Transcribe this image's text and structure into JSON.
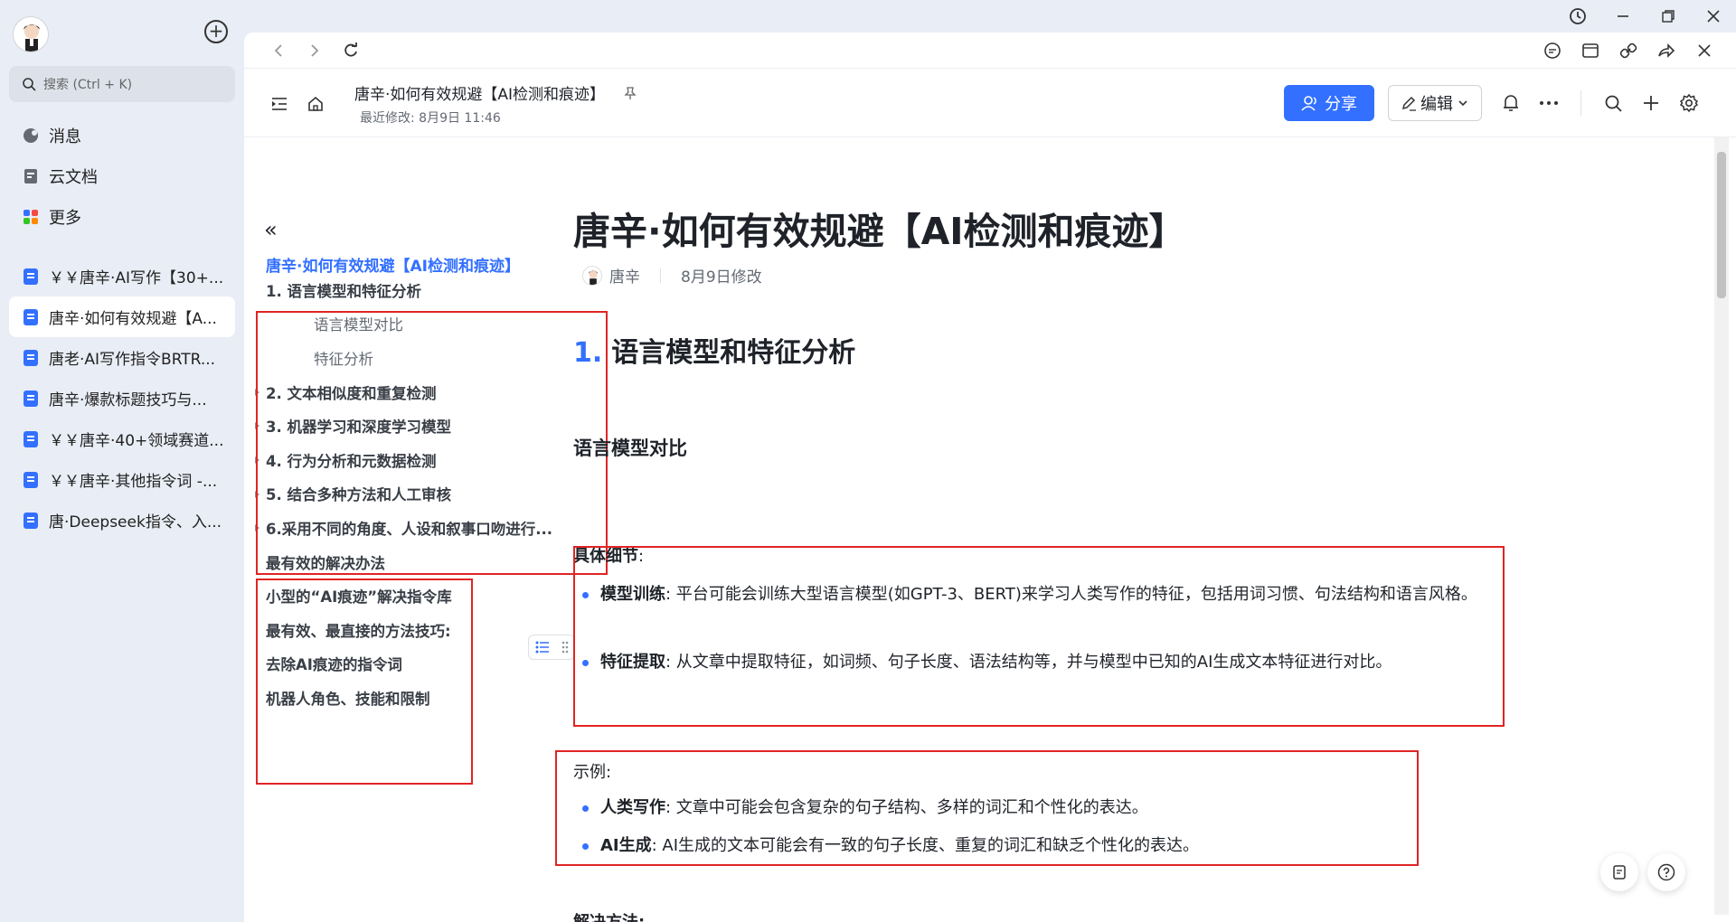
{
  "sidebar": {
    "search_placeholder": "搜索 (Ctrl + K)",
    "nav": [
      {
        "label": "消息",
        "icon": "message-icon"
      },
      {
        "label": "云文档",
        "icon": "cloud-doc-icon"
      },
      {
        "label": "更多",
        "icon": "apps-icon"
      }
    ],
    "docs": [
      {
        "label": "￥￥唐辛·AI写作【30+..."
      },
      {
        "label": "唐辛·如何有效规避【A...",
        "active": true
      },
      {
        "label": "唐老·AI写作指令BRTR..."
      },
      {
        "label": "唐辛·爆款标题技巧与..."
      },
      {
        "label": "￥￥唐辛·40+领域赛道..."
      },
      {
        "label": "￥￥唐辛·其他指令词 -..."
      },
      {
        "label": "唐·Deepseek指令、入..."
      }
    ]
  },
  "header": {
    "title": "唐辛·如何有效规避【AI检测和痕迹】",
    "last_modified": "最近修改: 8月9日 11:46",
    "share_label": "分享",
    "edit_label": "编辑"
  },
  "outline": {
    "title": "唐辛·如何有效规避【AI检测和痕迹】",
    "items": [
      {
        "label": "1. 语言模型和特征分析",
        "level": 1
      },
      {
        "label": "语言模型对比",
        "level": 2
      },
      {
        "label": "特征分析",
        "level": 2
      },
      {
        "label": "2. 文本相似度和重复检测",
        "level": 1
      },
      {
        "label": "3. 机器学习和深度学习模型",
        "level": 1
      },
      {
        "label": "4. 行为分析和元数据检测",
        "level": 1
      },
      {
        "label": "5. 结合多种方法和人工审核",
        "level": 1
      },
      {
        "label": "6.采用不同的角度、人设和叙事口吻进行...",
        "level": 1
      },
      {
        "label": "最有效的解决办法",
        "level": 1
      },
      {
        "label": "小型的“AI痕迹”解决指令库",
        "level": 1
      },
      {
        "label": "最有效、最直接的方法技巧:",
        "level": 1
      },
      {
        "label": "去除AI痕迹的指令词",
        "level": 1
      },
      {
        "label": "机器人角色、技能和限制",
        "level": 1
      }
    ]
  },
  "doc": {
    "title": "唐辛·如何有效规避【AI检测和痕迹】",
    "author": "唐辛",
    "modified": "8月9日修改",
    "h1_num": "1.",
    "h1_text": "语言模型和特征分析",
    "h3": "语言模型对比",
    "details_label": "具体细节",
    "details_colon": ":",
    "bullets1": [
      {
        "bold": "模型训练",
        "text": ": 平台可能会训练大型语言模型(如GPT-3、BERT)来学习人类写作的特征，包括用词习惯、句法结构和语言风格。"
      },
      {
        "bold": "特征提取",
        "text": ": 从文章中提取特征，如词频、句子长度、语法结构等，并与模型中已知的AI生成文本特征进行对比。"
      }
    ],
    "example_label": "示例:",
    "bullets2": [
      {
        "bold": "人类写作",
        "text": ": 文章中可能会包含复杂的句子结构、多样的词汇和个性化的表达。"
      },
      {
        "bold": "AI生成",
        "text": ": AI生成的文本可能会有一致的句子长度、重复的词汇和缺乏个性化的表达。"
      }
    ],
    "solution_label": "解决方法:"
  },
  "colors": {
    "accent": "#3370ff",
    "highlight_box": "#e02424"
  }
}
